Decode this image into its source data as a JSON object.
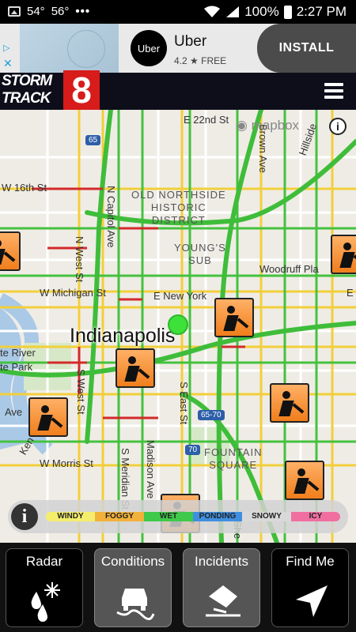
{
  "status_bar": {
    "temp1": "54°",
    "temp2": "56°",
    "dots": "•••",
    "battery": "100%",
    "time": "2:27 PM"
  },
  "ad": {
    "brand_logo": "Uber",
    "brand_name": "Uber",
    "rating": "4.2 ★ FREE",
    "install_label": "INSTALL",
    "adchoice_icon": "ad-choices-icon"
  },
  "header": {
    "logo_line1": "STORM",
    "logo_line2": "TRACK",
    "logo_number": "8",
    "menu_icon": "hamburger-menu-icon",
    "logo_accent": "#d81b1b"
  },
  "map": {
    "attribution": "mapbox",
    "labels": {
      "e22nd": "E 22nd St",
      "w16th": "W 16th St",
      "capitol": "N Capitol Ave",
      "old_northside": "OLD NORTHSIDE\nHISTORIC\nDISTRICT",
      "youngs_sub": "YOUNG'S\nSUB",
      "woodruff": "Woodruff Pla",
      "west_st_n": "N West St",
      "michigan": "W Michigan St",
      "new_york": "E New York",
      "city": "Indianapolis",
      "white_river1": "te River",
      "white_river2": "te Park",
      "west_st_s": "S West St",
      "east_st": "S East St",
      "shield_6570": "65-70",
      "shield_70": "70",
      "shield_65": "65",
      "ave": "Ave",
      "ken": "Ken",
      "morris": "W Morris St",
      "meridian": "S Meridian St",
      "madison": "Madison Ave",
      "fountain": "FOUNTAIN\nSQUARE",
      "brown": "Brown Ave",
      "hillside": "Hillside",
      "e_edge": "E",
      "she": "She"
    }
  },
  "legend": {
    "info_label": "i",
    "items": [
      {
        "label": "WINDY",
        "color": "#f4ee6c"
      },
      {
        "label": "FOGGY",
        "color": "#f2b13a"
      },
      {
        "label": "WET",
        "color": "#3ec94a"
      },
      {
        "label": "PONDING",
        "color": "#3f8fe0"
      },
      {
        "label": "SNOWY",
        "color": "#d9d9d9"
      },
      {
        "label": "ICY",
        "color": "#f06fa0"
      }
    ]
  },
  "nav": {
    "radar": "Radar",
    "conditions": "Conditions",
    "incidents": "Incidents",
    "find_me": "Find Me"
  }
}
